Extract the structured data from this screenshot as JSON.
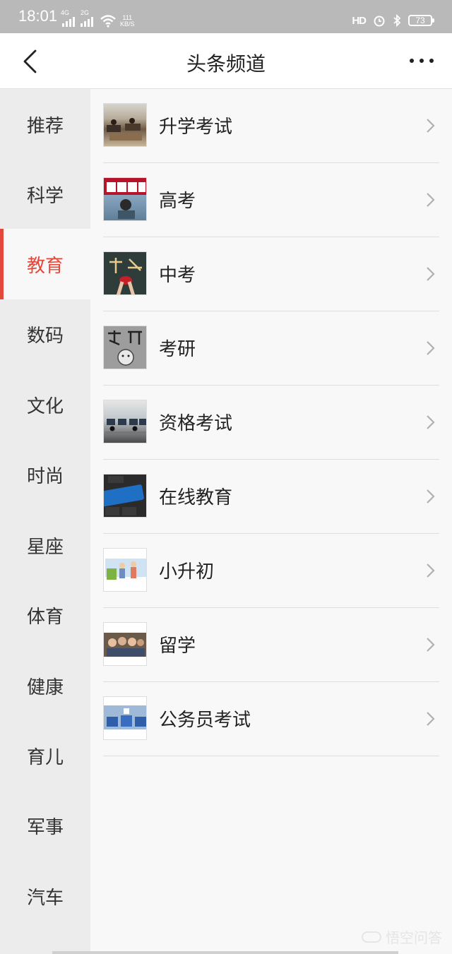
{
  "status_bar": {
    "time": "18:01",
    "net1": "4G",
    "net2": "2G",
    "speed_value": "111",
    "speed_unit": "KB/S",
    "hd": "HD",
    "battery": "73"
  },
  "header": {
    "title": "头条频道"
  },
  "sidebar": {
    "items": [
      {
        "label": "推荐"
      },
      {
        "label": "科学"
      },
      {
        "label": "教育"
      },
      {
        "label": "数码"
      },
      {
        "label": "文化"
      },
      {
        "label": "时尚"
      },
      {
        "label": "星座"
      },
      {
        "label": "体育"
      },
      {
        "label": "健康"
      },
      {
        "label": "育儿"
      },
      {
        "label": "军事"
      },
      {
        "label": "汽车"
      }
    ],
    "active": "教育"
  },
  "channels": [
    {
      "label": "升学考试",
      "icon": "classroom-photo-icon"
    },
    {
      "label": "高考",
      "icon": "gaokao-photo-icon"
    },
    {
      "label": "中考",
      "icon": "zhongkao-photo-icon"
    },
    {
      "label": "考研",
      "icon": "kaoyan-photo-icon"
    },
    {
      "label": "资格考试",
      "icon": "exam-hall-photo-icon"
    },
    {
      "label": "在线教育",
      "icon": "learning-key-photo-icon"
    },
    {
      "label": "小升初",
      "icon": "cartoon-photo-icon"
    },
    {
      "label": "留学",
      "icon": "students-photo-icon"
    },
    {
      "label": "公务员考试",
      "icon": "exam-room-photo-icon"
    }
  ],
  "watermark": "悟空问答",
  "colors": {
    "accent": "#e2493a",
    "sidebar_bg": "#ececec",
    "status_bar_bg": "#b9b9b9"
  }
}
